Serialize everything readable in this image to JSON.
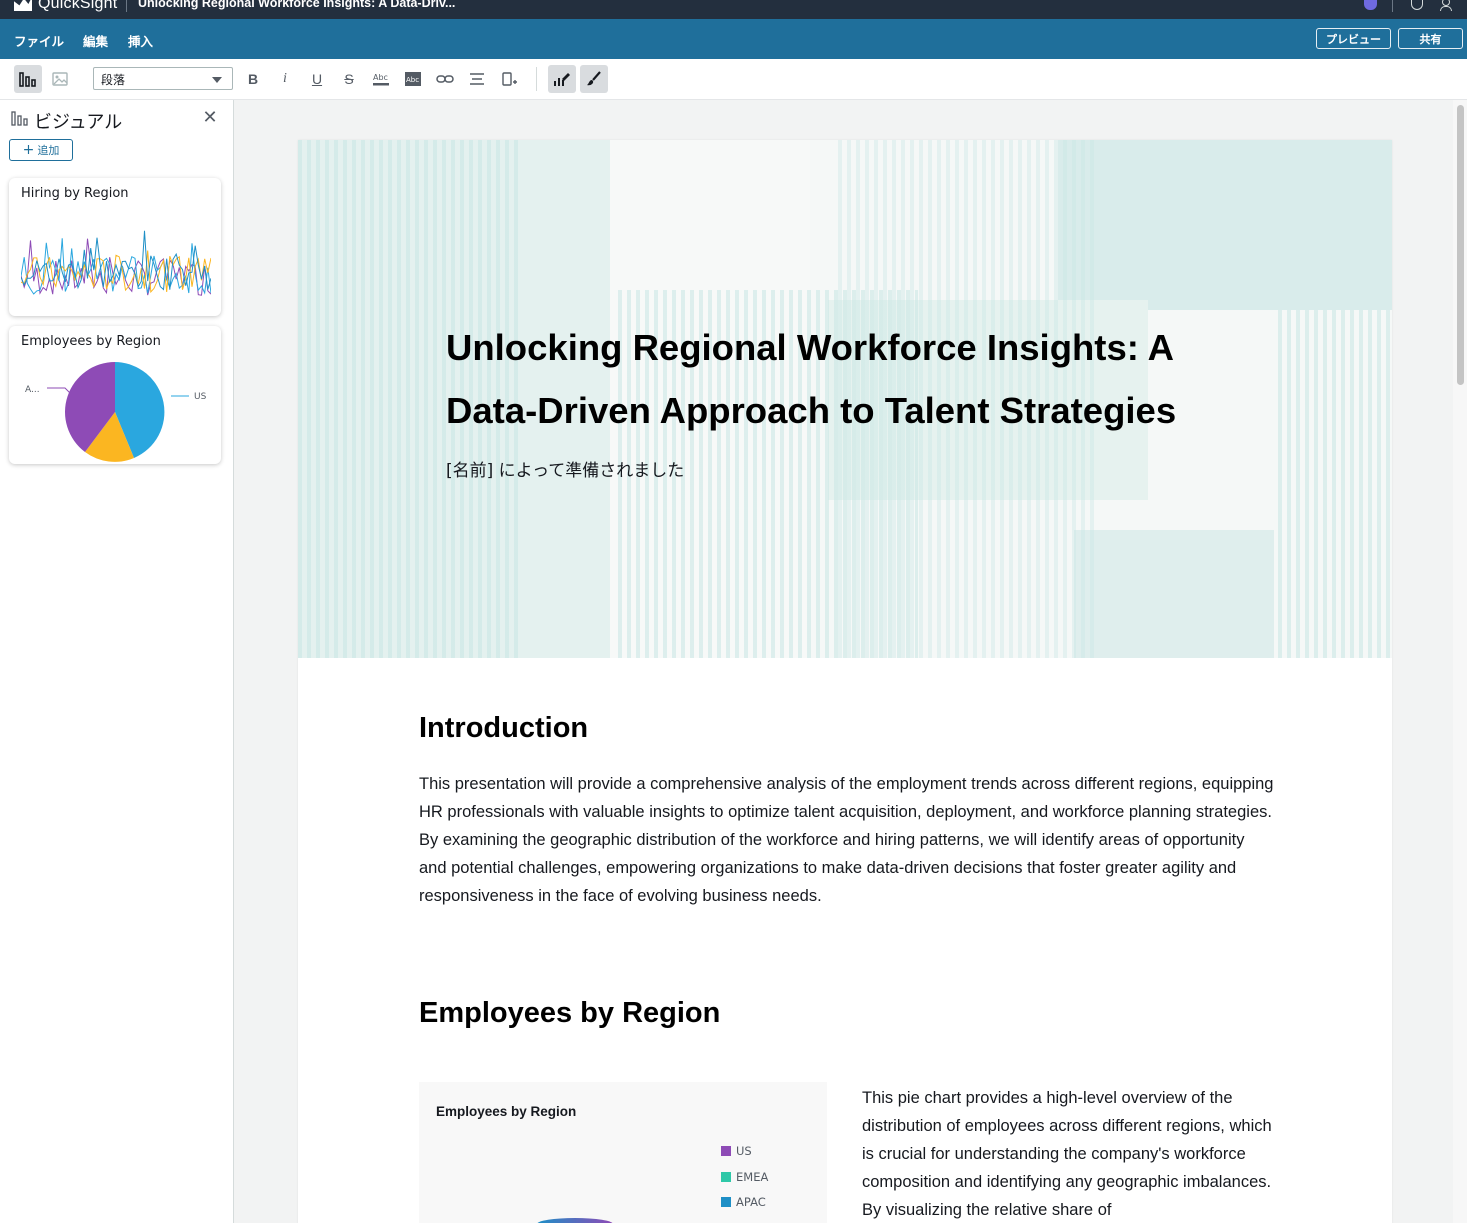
{
  "app": {
    "brand": "QuickSight",
    "doc_title": "Unlocking Regional Workforce Insights: A Data-Driv..."
  },
  "menubar": {
    "items": [
      "ファイル",
      "編集",
      "挿入"
    ],
    "preview_label": "プレビュー",
    "share_label": "共有"
  },
  "toolbar": {
    "paragraph_style": "段落",
    "bold": "B",
    "italic": "i",
    "underline": "U",
    "strikethrough": "S"
  },
  "visuals_panel": {
    "title": "ビジュアル",
    "add_label": "追加",
    "cards": [
      {
        "title": "Hiring by Region"
      },
      {
        "title": "Employees by Region",
        "labels": [
          "A...",
          "US"
        ]
      }
    ]
  },
  "story": {
    "hero_title": "Unlocking Regional Workforce Insights: A Data-Driven Approach to Talent Strategies",
    "hero_subtitle": "[名前] によって準備されました",
    "intro_heading": "Introduction",
    "intro_text": "This presentation will provide a comprehensive analysis of the employment trends across different regions, equipping HR professionals with valuable insights to optimize talent acquisition, deployment, and workforce planning strategies. By examining the geographic distribution of the workforce and hiring patterns, we will identify areas of opportunity and potential challenges, empowering organizations to make data-driven decisions that foster greater agility and responsiveness in the face of evolving business needs.",
    "emp_heading": "Employees by Region",
    "emp_text": "This pie chart provides a high-level overview of the distribution of employees across different regions, which is crucial for understanding the company's workforce composition and identifying any geographic imbalances. By visualizing the relative share of"
  },
  "embedded_chart": {
    "title": "Employees by Region",
    "legend": [
      {
        "label": "US",
        "color": "#8e4bb6"
      },
      {
        "label": "EMEA",
        "color": "#2ec8a8"
      },
      {
        "label": "APAC",
        "color": "#1e8fc6"
      }
    ]
  },
  "colors": {
    "topbar": "#232f3e",
    "menubar": "#1f6f9b",
    "pie_purple": "#8e4bb6",
    "pie_blue": "#2aa7df",
    "pie_yellow": "#fbb621"
  }
}
